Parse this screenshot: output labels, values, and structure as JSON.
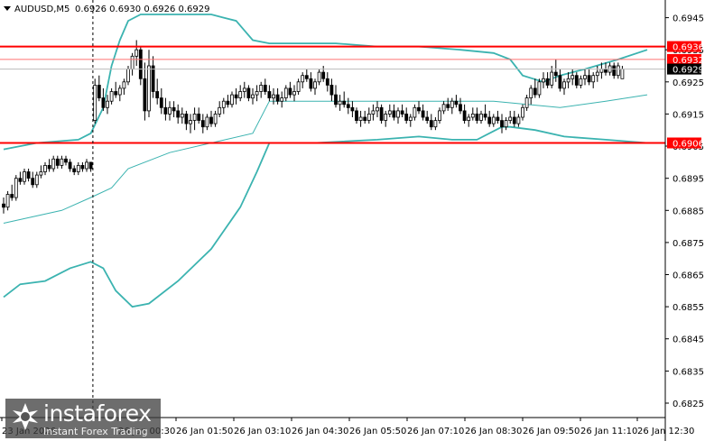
{
  "chart_data": {
    "type": "candlestick",
    "symbol_header": "AUDUSD,M5",
    "ohlc_header": "0.6926 0.6930 0.6926 0.6929",
    "y_ticks": [
      "0.6945",
      "0.6935",
      "0.6925",
      "0.6915",
      "0.6905",
      "0.6895",
      "0.6885",
      "0.6875",
      "0.6865",
      "0.6855",
      "0.6845",
      "0.6835",
      "0.6825"
    ],
    "ylim": [
      0.68205,
      0.69505
    ],
    "x_ticks": [
      "23 Jan 2026",
      "26 Jan 00:30",
      "26 Jan 01:50",
      "26 Jan 03:10",
      "26 Jan 04:30",
      "26 Jan 05:50",
      "26 Jan 07:10",
      "26 Jan 08:30",
      "26 Jan 09:50",
      "26 Jan 11:10",
      "26 Jan 12:30"
    ],
    "session_separator_after_bar": 21,
    "levels": [
      {
        "label": "0.6936",
        "value": 0.6936,
        "color": "#ff0000"
      },
      {
        "label": "0.6906",
        "value": 0.6906,
        "color": "#ff0000"
      }
    ],
    "price_tags": [
      {
        "label": "0.6932",
        "value": 0.6932,
        "bg": "#ff0000",
        "fg": "#ffffff"
      },
      {
        "label": "0.6929",
        "value": 0.6929,
        "bg": "#000000",
        "fg": "#ffffff"
      }
    ],
    "ohlc": [
      [
        0.6887,
        0.6889,
        0.6884,
        0.6886
      ],
      [
        0.6886,
        0.6891,
        0.6885,
        0.689
      ],
      [
        0.689,
        0.6893,
        0.6888,
        0.6889
      ],
      [
        0.6889,
        0.6896,
        0.6888,
        0.6895
      ],
      [
        0.6895,
        0.6897,
        0.6893,
        0.6894
      ],
      [
        0.6894,
        0.6898,
        0.6893,
        0.6897
      ],
      [
        0.6897,
        0.6898,
        0.6894,
        0.6895
      ],
      [
        0.6895,
        0.6897,
        0.6892,
        0.6893
      ],
      [
        0.6893,
        0.6897,
        0.6892,
        0.6896
      ],
      [
        0.6896,
        0.6899,
        0.6895,
        0.6897
      ],
      [
        0.6897,
        0.69,
        0.6896,
        0.6899
      ],
      [
        0.6899,
        0.6901,
        0.6897,
        0.6898
      ],
      [
        0.6898,
        0.6902,
        0.6897,
        0.6901
      ],
      [
        0.6901,
        0.6902,
        0.6898,
        0.6899
      ],
      [
        0.6899,
        0.6902,
        0.6898,
        0.6901
      ],
      [
        0.6901,
        0.6902,
        0.6899,
        0.69
      ],
      [
        0.69,
        0.6901,
        0.6897,
        0.6898
      ],
      [
        0.6898,
        0.6899,
        0.6896,
        0.6897
      ],
      [
        0.6897,
        0.69,
        0.6896,
        0.6899
      ],
      [
        0.6899,
        0.69,
        0.6897,
        0.6898
      ],
      [
        0.6898,
        0.6901,
        0.6897,
        0.69
      ],
      [
        0.69,
        0.69,
        0.6897,
        0.6898
      ],
      [
        0.6913,
        0.6926,
        0.6912,
        0.6924
      ],
      [
        0.6924,
        0.6927,
        0.6919,
        0.692
      ],
      [
        0.692,
        0.6923,
        0.6916,
        0.6917
      ],
      [
        0.6917,
        0.6921,
        0.6915,
        0.6919
      ],
      [
        0.6919,
        0.6923,
        0.6918,
        0.6922
      ],
      [
        0.6922,
        0.6925,
        0.692,
        0.6921
      ],
      [
        0.6921,
        0.6924,
        0.6919,
        0.6923
      ],
      [
        0.6923,
        0.6926,
        0.6921,
        0.6925
      ],
      [
        0.6925,
        0.693,
        0.6924,
        0.6929
      ],
      [
        0.6929,
        0.6934,
        0.6927,
        0.6933
      ],
      [
        0.6933,
        0.6938,
        0.693,
        0.6935
      ],
      [
        0.6935,
        0.6936,
        0.6924,
        0.6926
      ],
      [
        0.6926,
        0.6931,
        0.6913,
        0.6916
      ],
      [
        0.6916,
        0.6935,
        0.6914,
        0.693
      ],
      [
        0.693,
        0.6933,
        0.692,
        0.6922
      ],
      [
        0.6922,
        0.6926,
        0.6918,
        0.692
      ],
      [
        0.692,
        0.6923,
        0.6915,
        0.6917
      ],
      [
        0.6917,
        0.692,
        0.6913,
        0.6915
      ],
      [
        0.6915,
        0.6919,
        0.6913,
        0.6917
      ],
      [
        0.6917,
        0.6919,
        0.6914,
        0.6916
      ],
      [
        0.6916,
        0.6918,
        0.6912,
        0.6914
      ],
      [
        0.6914,
        0.6917,
        0.6912,
        0.6915
      ],
      [
        0.6915,
        0.6916,
        0.691,
        0.6912
      ],
      [
        0.6912,
        0.6915,
        0.6909,
        0.6913
      ],
      [
        0.6913,
        0.6917,
        0.691,
        0.6915
      ],
      [
        0.6915,
        0.6917,
        0.6912,
        0.6913
      ],
      [
        0.6913,
        0.6915,
        0.6909,
        0.6911
      ],
      [
        0.6911,
        0.6915,
        0.691,
        0.6914
      ],
      [
        0.6914,
        0.6916,
        0.6911,
        0.6912
      ],
      [
        0.6912,
        0.6916,
        0.6911,
        0.6915
      ],
      [
        0.6915,
        0.6919,
        0.6914,
        0.6917
      ],
      [
        0.6917,
        0.692,
        0.6915,
        0.6919
      ],
      [
        0.6919,
        0.6921,
        0.6917,
        0.6918
      ],
      [
        0.6918,
        0.6922,
        0.6917,
        0.6921
      ],
      [
        0.6921,
        0.6923,
        0.6918,
        0.692
      ],
      [
        0.692,
        0.6924,
        0.6919,
        0.6922
      ],
      [
        0.6922,
        0.6925,
        0.692,
        0.6923
      ],
      [
        0.6923,
        0.6924,
        0.6919,
        0.692
      ],
      [
        0.692,
        0.6923,
        0.6918,
        0.6921
      ],
      [
        0.6921,
        0.6924,
        0.6919,
        0.6922
      ],
      [
        0.6922,
        0.6925,
        0.692,
        0.6924
      ],
      [
        0.6924,
        0.6926,
        0.6921,
        0.6922
      ],
      [
        0.6922,
        0.6924,
        0.6919,
        0.692
      ],
      [
        0.692,
        0.6923,
        0.6918,
        0.6921
      ],
      [
        0.6921,
        0.6923,
        0.6918,
        0.6919
      ],
      [
        0.6919,
        0.6922,
        0.6917,
        0.692
      ],
      [
        0.692,
        0.6924,
        0.6919,
        0.6923
      ],
      [
        0.6923,
        0.6925,
        0.692,
        0.6921
      ],
      [
        0.6921,
        0.6924,
        0.6919,
        0.6922
      ],
      [
        0.6922,
        0.6926,
        0.6921,
        0.6925
      ],
      [
        0.6925,
        0.6928,
        0.6923,
        0.6927
      ],
      [
        0.6927,
        0.6929,
        0.6925,
        0.6926
      ],
      [
        0.6926,
        0.6928,
        0.6922,
        0.6923
      ],
      [
        0.6923,
        0.6926,
        0.6921,
        0.6925
      ],
      [
        0.6925,
        0.6929,
        0.6924,
        0.6928
      ],
      [
        0.6928,
        0.693,
        0.6925,
        0.6926
      ],
      [
        0.6926,
        0.6928,
        0.6922,
        0.6924
      ],
      [
        0.6924,
        0.6926,
        0.6919,
        0.6921
      ],
      [
        0.6921,
        0.6924,
        0.6917,
        0.6918
      ],
      [
        0.6918,
        0.6921,
        0.6916,
        0.6919
      ],
      [
        0.6919,
        0.6922,
        0.6917,
        0.6918
      ],
      [
        0.6918,
        0.692,
        0.6915,
        0.6917
      ],
      [
        0.6917,
        0.6919,
        0.6914,
        0.6916
      ],
      [
        0.6916,
        0.6917,
        0.6912,
        0.6913
      ],
      [
        0.6913,
        0.6916,
        0.6911,
        0.6914
      ],
      [
        0.6914,
        0.6916,
        0.6912,
        0.6913
      ],
      [
        0.6913,
        0.6917,
        0.6912,
        0.6915
      ],
      [
        0.6915,
        0.6918,
        0.6913,
        0.6916
      ],
      [
        0.6916,
        0.6919,
        0.6914,
        0.6917
      ],
      [
        0.6917,
        0.6918,
        0.6912,
        0.6913
      ],
      [
        0.6913,
        0.6916,
        0.6911,
        0.6915
      ],
      [
        0.6915,
        0.6918,
        0.6914,
        0.6916
      ],
      [
        0.6916,
        0.6918,
        0.6913,
        0.6914
      ],
      [
        0.6914,
        0.6917,
        0.6912,
        0.6916
      ],
      [
        0.6916,
        0.6918,
        0.6914,
        0.6915
      ],
      [
        0.6915,
        0.6917,
        0.6912,
        0.6913
      ],
      [
        0.6913,
        0.6915,
        0.6911,
        0.6914
      ],
      [
        0.6914,
        0.6918,
        0.6913,
        0.6917
      ],
      [
        0.6917,
        0.6919,
        0.6915,
        0.6916
      ],
      [
        0.6916,
        0.6918,
        0.6913,
        0.6914
      ],
      [
        0.6914,
        0.6916,
        0.6912,
        0.6913
      ],
      [
        0.6913,
        0.6915,
        0.691,
        0.6911
      ],
      [
        0.6911,
        0.6914,
        0.691,
        0.6913
      ],
      [
        0.6913,
        0.6917,
        0.6912,
        0.6916
      ],
      [
        0.6916,
        0.6919,
        0.6915,
        0.6918
      ],
      [
        0.6918,
        0.692,
        0.6916,
        0.6917
      ],
      [
        0.6917,
        0.692,
        0.6915,
        0.6919
      ],
      [
        0.6919,
        0.6921,
        0.6917,
        0.6918
      ],
      [
        0.6918,
        0.692,
        0.6915,
        0.6916
      ],
      [
        0.6916,
        0.6918,
        0.6912,
        0.6913
      ],
      [
        0.6913,
        0.6915,
        0.6911,
        0.6914
      ],
      [
        0.6914,
        0.6917,
        0.6913,
        0.6915
      ],
      [
        0.6915,
        0.6917,
        0.6912,
        0.6913
      ],
      [
        0.6913,
        0.6916,
        0.6912,
        0.6915
      ],
      [
        0.6915,
        0.6918,
        0.6913,
        0.6914
      ],
      [
        0.6914,
        0.6916,
        0.6911,
        0.6912
      ],
      [
        0.6912,
        0.6915,
        0.6911,
        0.6914
      ],
      [
        0.6914,
        0.6916,
        0.6912,
        0.6913
      ],
      [
        0.6913,
        0.6915,
        0.6909,
        0.6911
      ],
      [
        0.6911,
        0.6914,
        0.691,
        0.6913
      ],
      [
        0.6913,
        0.6916,
        0.6912,
        0.6914
      ],
      [
        0.6914,
        0.6916,
        0.6911,
        0.6912
      ],
      [
        0.6912,
        0.6915,
        0.6911,
        0.6914
      ],
      [
        0.6914,
        0.6918,
        0.6913,
        0.6917
      ],
      [
        0.6917,
        0.6921,
        0.6916,
        0.692
      ],
      [
        0.692,
        0.6924,
        0.6918,
        0.6923
      ],
      [
        0.6923,
        0.6926,
        0.692,
        0.6921
      ],
      [
        0.6921,
        0.6926,
        0.692,
        0.6925
      ],
      [
        0.6925,
        0.6928,
        0.6923,
        0.6926
      ],
      [
        0.6926,
        0.6928,
        0.6923,
        0.6924
      ],
      [
        0.6924,
        0.693,
        0.6923,
        0.6928
      ],
      [
        0.6928,
        0.6932,
        0.6925,
        0.6927
      ],
      [
        0.6927,
        0.6929,
        0.6922,
        0.6923
      ],
      [
        0.6923,
        0.6926,
        0.6921,
        0.6925
      ],
      [
        0.6925,
        0.6928,
        0.6923,
        0.6926
      ],
      [
        0.6926,
        0.6929,
        0.6924,
        0.6927
      ],
      [
        0.6927,
        0.6928,
        0.6923,
        0.6924
      ],
      [
        0.6924,
        0.6927,
        0.6923,
        0.6926
      ],
      [
        0.6926,
        0.6929,
        0.6924,
        0.6927
      ],
      [
        0.6927,
        0.6929,
        0.6924,
        0.6925
      ],
      [
        0.6925,
        0.6928,
        0.6923,
        0.6927
      ],
      [
        0.6927,
        0.693,
        0.6925,
        0.6928
      ],
      [
        0.6928,
        0.6931,
        0.6926,
        0.6929
      ],
      [
        0.6929,
        0.6931,
        0.6927,
        0.6928
      ],
      [
        0.6928,
        0.6931,
        0.6927,
        0.693
      ],
      [
        0.693,
        0.6931,
        0.6926,
        0.6927
      ],
      [
        0.6927,
        0.6931,
        0.6926,
        0.693
      ],
      [
        0.6926,
        0.693,
        0.6926,
        0.6929
      ]
    ],
    "bollinger_upper": [
      [
        0,
        0.6904
      ],
      [
        8,
        0.6906
      ],
      [
        18,
        0.6907
      ],
      [
        21,
        0.6909
      ],
      [
        24,
        0.6917
      ],
      [
        26,
        0.693
      ],
      [
        28,
        0.6938
      ],
      [
        30,
        0.6944
      ],
      [
        33,
        0.6946
      ],
      [
        38,
        0.6946
      ],
      [
        45,
        0.6946
      ],
      [
        50,
        0.6946
      ],
      [
        53,
        0.6945
      ],
      [
        56,
        0.6944
      ],
      [
        58,
        0.6941
      ],
      [
        60,
        0.6938
      ],
      [
        64,
        0.6937
      ],
      [
        80,
        0.6937
      ],
      [
        90,
        0.6936
      ],
      [
        100,
        0.6936
      ],
      [
        110,
        0.6935
      ],
      [
        118,
        0.6934
      ],
      [
        122,
        0.6932
      ],
      [
        125,
        0.6927
      ],
      [
        130,
        0.6925
      ],
      [
        134,
        0.6927
      ],
      [
        140,
        0.6929
      ],
      [
        148,
        0.6932
      ],
      [
        155,
        0.6935
      ]
    ],
    "bollinger_middle": [
      [
        0,
        0.6881
      ],
      [
        14,
        0.6885
      ],
      [
        21,
        0.6889
      ],
      [
        26,
        0.6892
      ],
      [
        30,
        0.6898
      ],
      [
        40,
        0.6903
      ],
      [
        50,
        0.6906
      ],
      [
        60,
        0.6909
      ],
      [
        64,
        0.6919
      ],
      [
        75,
        0.6919
      ],
      [
        90,
        0.6919
      ],
      [
        105,
        0.6919
      ],
      [
        118,
        0.6919
      ],
      [
        126,
        0.6918
      ],
      [
        134,
        0.6917
      ],
      [
        145,
        0.6919
      ],
      [
        155,
        0.6921
      ]
    ],
    "bollinger_lower": [
      [
        0,
        0.6858
      ],
      [
        4,
        0.6862
      ],
      [
        10,
        0.6863
      ],
      [
        16,
        0.6867
      ],
      [
        21,
        0.6869
      ],
      [
        24,
        0.6867
      ],
      [
        27,
        0.686
      ],
      [
        31,
        0.6855
      ],
      [
        35,
        0.6856
      ],
      [
        42,
        0.6863
      ],
      [
        50,
        0.6873
      ],
      [
        57,
        0.6886
      ],
      [
        61,
        0.6897
      ],
      [
        64,
        0.6906
      ],
      [
        75,
        0.6906
      ],
      [
        90,
        0.6907
      ],
      [
        100,
        0.6908
      ],
      [
        108,
        0.6907
      ],
      [
        114,
        0.6907
      ],
      [
        120,
        0.6911
      ],
      [
        122,
        0.6911
      ],
      [
        128,
        0.691
      ],
      [
        135,
        0.6908
      ],
      [
        145,
        0.6907
      ],
      [
        155,
        0.6906
      ]
    ]
  },
  "watermark": {
    "brand": "instaforex",
    "subtitle": "Instant Forex Trading"
  }
}
